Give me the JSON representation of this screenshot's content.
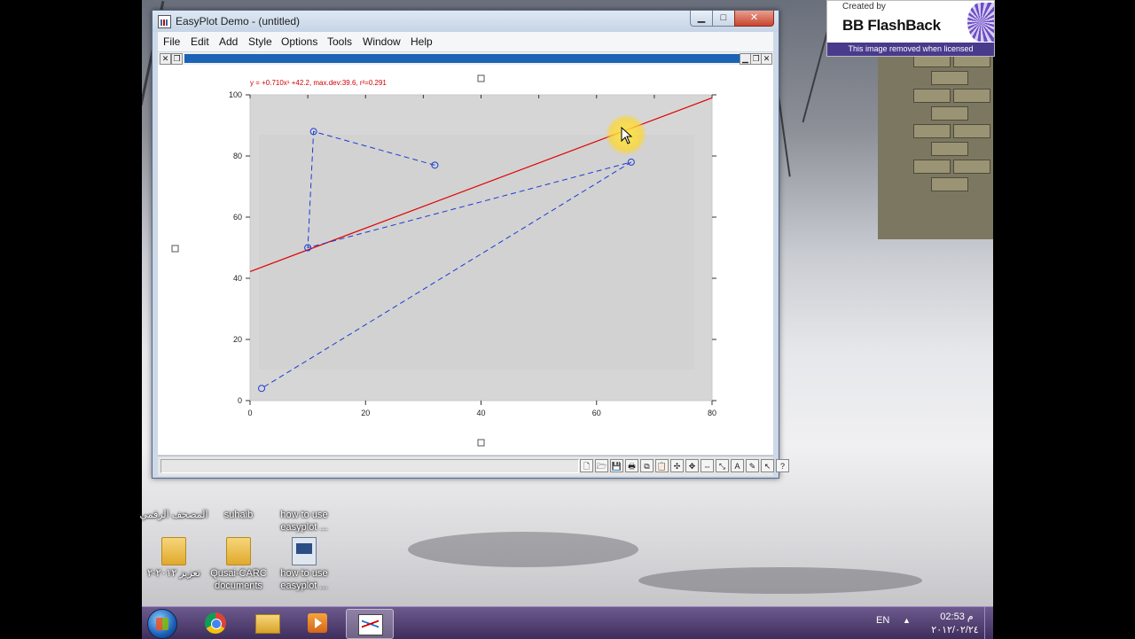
{
  "watermark": {
    "created_by": "Created by",
    "brand": "BB FlashBack",
    "notice": "This image removed when licensed"
  },
  "window": {
    "title": "EasyPlot Demo - (untitled)",
    "controls": {
      "minimize": "▁",
      "maximize": "□",
      "close": "✕"
    },
    "menu": [
      "File",
      "Edit",
      "Add",
      "Style",
      "Options",
      "Tools",
      "Window",
      "Help"
    ],
    "mdi_controls": {
      "minimize": "▁",
      "restore": "❐",
      "close": "✕"
    }
  },
  "chart_data": {
    "type": "scatter",
    "title": "",
    "fit_annotation": "y = +0.710x¹ +42.2, max.dev:39.6, r²=0.291",
    "xlabel": "",
    "ylabel": "",
    "xlim": [
      0,
      80
    ],
    "ylim": [
      0,
      100
    ],
    "x_ticks": [
      0,
      20,
      40,
      60,
      80
    ],
    "y_ticks": [
      0,
      20,
      40,
      60,
      80,
      100
    ],
    "grid": false,
    "colors": {
      "data": "#1a3cd4",
      "fit": "#e00000",
      "annotation": "#d00000",
      "plot_bg": "#d6d6d6"
    },
    "series": [
      {
        "style": "dashed-line-with-circle-markers",
        "x": [
          32,
          11,
          10,
          66,
          2
        ],
        "y": [
          77,
          88,
          50,
          78,
          4
        ]
      }
    ],
    "fit_line": {
      "slope": 0.71,
      "intercept": 42.2,
      "x_range": [
        0,
        80
      ]
    }
  },
  "toolbar": {
    "icons": [
      "new-icon",
      "open-icon",
      "save-icon",
      "print-icon",
      "copy-icon",
      "paste-icon",
      "zoom-icon",
      "move-icon",
      "pan-icon",
      "scale-icon",
      "text-icon",
      "edit-icon",
      "pointer-icon",
      "help-icon"
    ],
    "glyphs": [
      "🗋",
      "🗁",
      "💾",
      "🖶",
      "⧉",
      "📋",
      "✣",
      "✥",
      "⇔",
      "⤡",
      "A",
      "✎",
      "↖",
      "?"
    ]
  },
  "desktop_icons": [
    {
      "label": "المصحف الرقمي",
      "type": "app"
    },
    {
      "label": "suhaib",
      "type": "folder"
    },
    {
      "label": "how to use easyplot ...",
      "type": "app"
    },
    {
      "label": "تعزيز ٢٠١٢-٢",
      "type": "folder"
    },
    {
      "label": "Qusai-CARC documents",
      "type": "folder"
    },
    {
      "label": "how to use easyplot ...",
      "type": "app"
    }
  ],
  "taskbar": {
    "language": "EN",
    "tray_arrow": "▲",
    "time": "02:53 م",
    "date": "٢٠١٢/٠٢/٢٤",
    "buttons": [
      "start-button",
      "chrome-button",
      "explorer-button",
      "media-button",
      "easyplot-button"
    ]
  }
}
